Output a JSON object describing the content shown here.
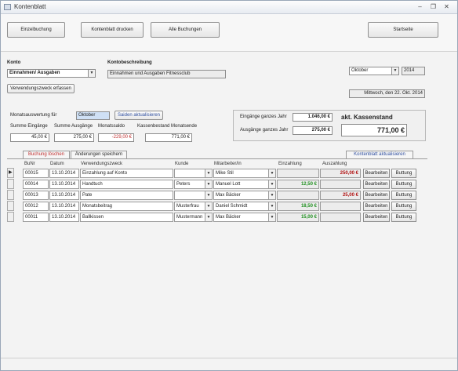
{
  "window": {
    "title": "Kontenblatt"
  },
  "toolbar": {
    "einzelbuchung": "Einzelbuchung",
    "kontenblatt_drucken": "Kontenblatt drucken",
    "alle_buchungen": "Alle Buchungen",
    "startseite": "Startseite"
  },
  "konto": {
    "label": "Konto",
    "value": "Einnahmen/ Ausgaben",
    "beschreibung_label": "Kontobeschreibung",
    "beschreibung": "Einnahmen und Ausgaben Fitnessclub",
    "verwendungszweck_button": "Verwendungszweck erfassen"
  },
  "period": {
    "month": "Oktober",
    "year": "2014",
    "date": "Mittwoch, den 22. Okt. 2014"
  },
  "monthly": {
    "label": "Monatsauswertung für",
    "month": "Oktober",
    "refresh_button": "Saiden aktualisieren",
    "sum_in_label": "Summe Eingänge",
    "sum_out_label": "Summe Ausgänge",
    "saldo_label": "Monatssaldo",
    "kassen_label": "Kassenbestand Monatsende",
    "sum_in": "45,00 €",
    "sum_out": "275,00 €",
    "saldo": "-229,00 €",
    "kassen": "771,00 €"
  },
  "yearly": {
    "in_label": "Eingänge ganzes Jahr",
    "out_label": "Ausgänge ganzes Jahr",
    "in_value": "1.046,00 €",
    "out_value": "275,00 €",
    "kassenstand_label": "akt. Kassenstand",
    "kassenstand": "771,00 €"
  },
  "tabs": {
    "buchung_loeschen": "Buchung löschen",
    "aenderungen_speichern": "Änderungen speichern",
    "kontenblatt_aktualisieren": "Kontenblatt aktualisieren"
  },
  "grid": {
    "headers": [
      "BuNr",
      "Datum",
      "Verwendungszweck",
      "Kunde",
      "Mitarbeiter/in",
      "Einzahlung",
      "Auszahlung"
    ],
    "edit_label": "Bearbeiten",
    "delete_label": "Buttung",
    "rows": [
      {
        "nr": "00015",
        "datum": "13.10.2014",
        "zweck": "Einzahlung auf Konto",
        "kunde": "",
        "mitarbeiter": "Mike Stil",
        "ein": "",
        "aus": "250,00 €"
      },
      {
        "nr": "00014",
        "datum": "13.10.2014",
        "zweck": "Handtuch",
        "kunde": "Peters",
        "mitarbeiter": "Manuel Lott",
        "ein": "12,50 €",
        "aus": ""
      },
      {
        "nr": "00013",
        "datum": "13.10.2014",
        "zweck": "Pate",
        "kunde": "",
        "mitarbeiter": "Max Bäcker",
        "ein": "",
        "aus": "25,00 €"
      },
      {
        "nr": "00012",
        "datum": "13.10.2014",
        "zweck": "Monatsbeitrag",
        "kunde": "Musterfrau",
        "mitarbeiter": "Daniel Schmidt",
        "ein": "18,50 €",
        "aus": ""
      },
      {
        "nr": "00011",
        "datum": "13.10.2014",
        "zweck": "Ballkissen",
        "kunde": "Mustermann",
        "mitarbeiter": "Max Bäcker",
        "ein": "15,00 €",
        "aus": ""
      }
    ]
  },
  "icons": {
    "window": "form-icon",
    "minimize": "minimize-icon",
    "restore": "restore-icon",
    "close": "close-icon",
    "dropdown": "chevron-down-icon"
  },
  "colors": {
    "red_value": "#c03030",
    "green_value": "#1f8f1f",
    "selection_blue": "#cfe0f5"
  }
}
